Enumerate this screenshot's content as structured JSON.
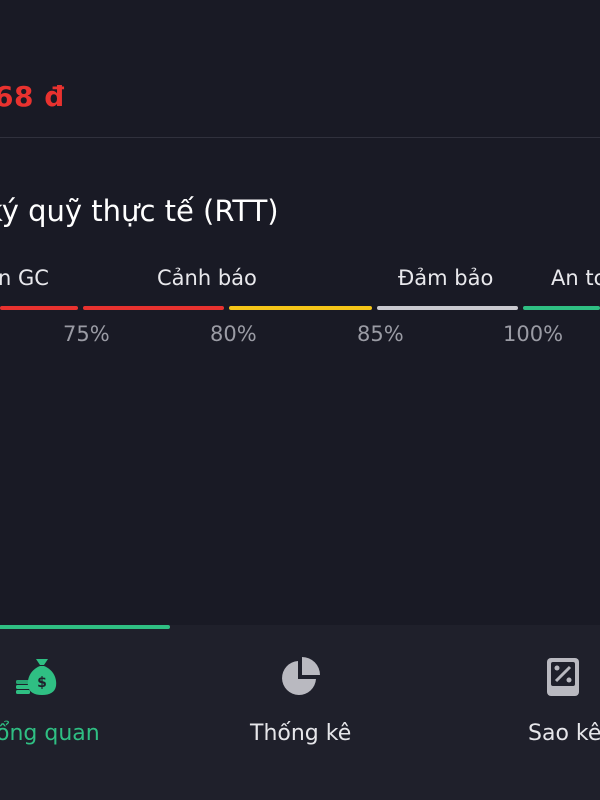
{
  "balance": {
    "amount_text": "68 đ",
    "color": "#e8322f"
  },
  "rtt": {
    "title": "ký quỹ thực tế (RTT)",
    "levels": [
      {
        "label": "n GC",
        "color": "#e8322f"
      },
      {
        "label": "Cảnh báo",
        "color": "#e8322f"
      },
      {
        "label": "",
        "color": "#f5c518"
      },
      {
        "label": "Đảm bảo",
        "color": "#c9c9cf"
      },
      {
        "label": "An to",
        "color": "#2fbf83"
      }
    ],
    "thresholds": [
      "75%",
      "80%",
      "85%",
      "100%"
    ]
  },
  "bottom_nav": {
    "accent": "#2fbf83",
    "items": [
      {
        "label": "ổng quan",
        "icon": "money-bag-icon",
        "active": true
      },
      {
        "label": "Thống kê",
        "icon": "pie-chart-icon",
        "active": false
      },
      {
        "label": "Sao kê",
        "icon": "statement-icon",
        "active": false
      }
    ]
  }
}
